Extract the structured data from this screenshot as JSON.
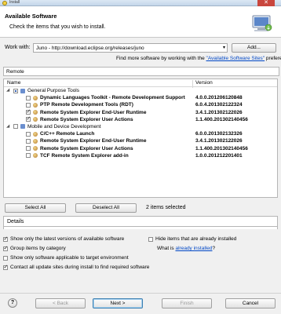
{
  "window": {
    "title": "Install",
    "close_glyph": "✕"
  },
  "banner": {
    "heading": "Available Software",
    "description": "Check the items that you wish to install."
  },
  "workwith": {
    "label": "Work with:",
    "value": "Juno - http://download.eclipse.org/releases/juno",
    "arrow": "▾",
    "add_label": "Add..."
  },
  "findmore": {
    "prefix": "Find more software by working with the ",
    "link": "\"Available Software Sites\"",
    "suffix": " prefere"
  },
  "filter": {
    "value": "Remote"
  },
  "tree": {
    "col_name": "Name",
    "col_version": "Version",
    "rows": [
      {
        "level": 0,
        "twisty": "◢",
        "check": "partial",
        "icon": "category",
        "name": "General Purpose Tools",
        "bold": false,
        "version": ""
      },
      {
        "level": 1,
        "twisty": "",
        "check": "none",
        "icon": "plugin",
        "name": "Dynamic Languages Toolkit - Remote Development Support",
        "bold": true,
        "version": "4.0.0.201206120848"
      },
      {
        "level": 1,
        "twisty": "",
        "check": "none",
        "icon": "plugin",
        "name": "PTP Remote Development Tools (RDT)",
        "bold": true,
        "version": "6.0.4.201302122324"
      },
      {
        "level": 1,
        "twisty": "",
        "check": "checked",
        "icon": "plugin",
        "name": "Remote System Explorer End-User Runtime",
        "bold": true,
        "version": "3.4.1.201302122026"
      },
      {
        "level": 1,
        "twisty": "",
        "check": "checked",
        "icon": "plugin",
        "name": "Remote System Explorer User Actions",
        "bold": true,
        "version": "1.1.400.201302140456"
      },
      {
        "level": 0,
        "twisty": "◢",
        "check": "none",
        "icon": "category",
        "name": "Mobile and Device Development",
        "bold": false,
        "version": ""
      },
      {
        "level": 1,
        "twisty": "",
        "check": "none",
        "icon": "plugin",
        "name": "C/C++ Remote Launch",
        "bold": true,
        "version": "6.0.0.201302132326"
      },
      {
        "level": 1,
        "twisty": "",
        "check": "none",
        "icon": "plugin",
        "name": "Remote System Explorer End-User Runtime",
        "bold": true,
        "version": "3.4.1.201302122026"
      },
      {
        "level": 1,
        "twisty": "",
        "check": "none",
        "icon": "plugin",
        "name": "Remote System Explorer User Actions",
        "bold": true,
        "version": "1.1.400.201302140456"
      },
      {
        "level": 1,
        "twisty": "",
        "check": "none",
        "icon": "plugin",
        "name": "TCF Remote System Explorer add-in",
        "bold": true,
        "version": "1.0.0.201212201401"
      }
    ]
  },
  "selection": {
    "select_all": "Select All",
    "deselect_all": "Deselect All",
    "count": "2 items selected"
  },
  "details": {
    "label": "Details"
  },
  "options": {
    "latest_only": {
      "label": "Show only the latest versions of available software",
      "checked": true
    },
    "hide_installed": {
      "label": "Hide items that are already installed",
      "checked": false
    },
    "group_by_category": {
      "label": "Group items by category",
      "checked": true
    },
    "what_is_prefix": "What is ",
    "what_is_link": "already installed",
    "what_is_suffix": "?",
    "target_env": {
      "label": "Show only software applicable to target environment",
      "checked": false
    },
    "contact_sites": {
      "label": "Contact all update sites during install to find required software",
      "checked": true
    }
  },
  "footer": {
    "help_glyph": "?",
    "back": "< Back",
    "next": "Next >",
    "finish": "Finish",
    "cancel": "Cancel"
  },
  "colors": {
    "link": "#0047c6",
    "default_button_border": "#3c7fb1",
    "title_bar_close": "#c9463d"
  }
}
